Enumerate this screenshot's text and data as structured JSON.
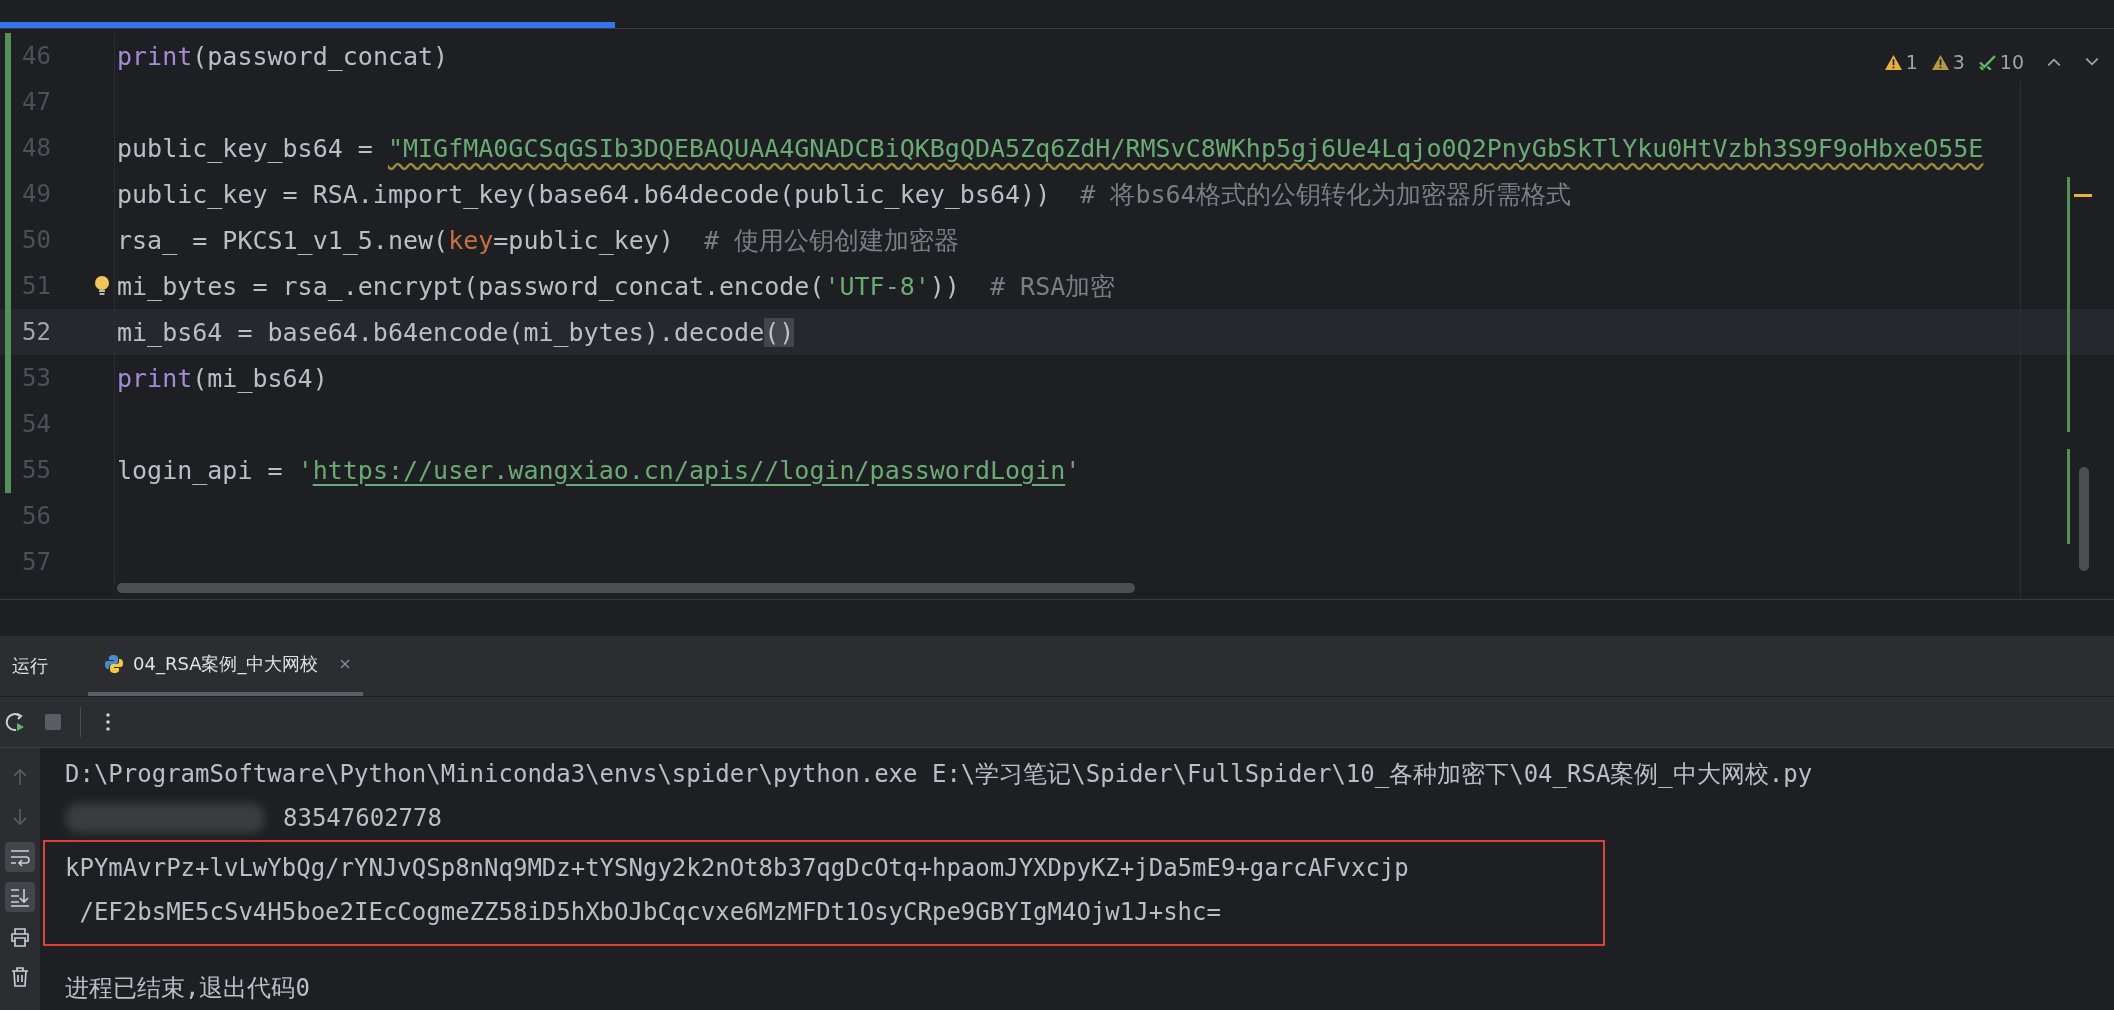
{
  "editor": {
    "inspections": [
      {
        "kind": "warning",
        "count": "1"
      },
      {
        "kind": "weak_warning",
        "count": "3"
      },
      {
        "kind": "typo",
        "count": "10"
      }
    ],
    "lines": [
      {
        "number": "46",
        "changed": true,
        "current": false,
        "bulb": false,
        "tokens": [
          {
            "kind": "fn",
            "text": "print"
          },
          {
            "kind": "plain",
            "text": "(password_concat)"
          }
        ]
      },
      {
        "number": "47",
        "changed": true,
        "current": false,
        "bulb": false
      },
      {
        "number": "48",
        "changed": true,
        "current": false,
        "bulb": false,
        "tokens": [
          {
            "kind": "plain",
            "text": "public_key_bs64 = "
          },
          {
            "kind": "str_wavy",
            "text": "\"MIGfMA0GCSqGSIb3DQEBAQUAA4GNADCBiQKBgQDA5Zq6ZdH/RMSvC8WKhp5gj6Ue4Lqjo0Q2PnyGbSkTlYku0HtVzbh3S9F9oHbxeO55E"
          }
        ]
      },
      {
        "number": "49",
        "changed": true,
        "current": false,
        "bulb": false,
        "tokens": [
          {
            "kind": "plain",
            "text": "public_key = RSA.import_key(base64.b64decode(public_key_bs64))  "
          },
          {
            "kind": "comment",
            "text": "# 将bs64格式的公钥转化为加密器所需格式"
          }
        ]
      },
      {
        "number": "50",
        "changed": true,
        "current": false,
        "bulb": false,
        "tokens": [
          {
            "kind": "plain",
            "text": "rsa_ = PKCS1_v1_5.new("
          },
          {
            "kind": "param",
            "text": "key"
          },
          {
            "kind": "plain",
            "text": "=public_key)  "
          },
          {
            "kind": "comment",
            "text": "# 使用公钥创建加密器"
          }
        ]
      },
      {
        "number": "51",
        "changed": true,
        "current": false,
        "bulb": true,
        "tokens": [
          {
            "kind": "plain",
            "text": "mi_bytes = rsa_.encrypt(password_concat.encode("
          },
          {
            "kind": "str",
            "text": "'UTF-8'"
          },
          {
            "kind": "plain",
            "text": "))  "
          },
          {
            "kind": "comment",
            "text": "# RSA加密"
          }
        ]
      },
      {
        "number": "52",
        "changed": true,
        "current": true,
        "bulb": false,
        "tokens": [
          {
            "kind": "plain",
            "text": "mi_bs64 = base64.b64encode(mi_bytes).decode"
          },
          {
            "kind": "brace",
            "text": "()"
          }
        ]
      },
      {
        "number": "53",
        "changed": true,
        "current": false,
        "bulb": false,
        "tokens": [
          {
            "kind": "fn",
            "text": "print"
          },
          {
            "kind": "plain",
            "text": "(mi_bs64)"
          }
        ]
      },
      {
        "number": "54",
        "changed": true,
        "current": false,
        "bulb": false
      },
      {
        "number": "55",
        "changed": true,
        "current": false,
        "bulb": false,
        "tokens": [
          {
            "kind": "plain",
            "text": "login_api = "
          },
          {
            "kind": "str",
            "text": "'"
          },
          {
            "kind": "url",
            "text": "https://user.wangxiao.cn/apis//login/passwordLogin"
          },
          {
            "kind": "str",
            "text": "'"
          }
        ]
      },
      {
        "number": "56",
        "changed": false,
        "current": false,
        "bulb": false
      },
      {
        "number": "57",
        "changed": false,
        "current": false,
        "bulb": false
      }
    ]
  },
  "run_panel": {
    "title": "运行",
    "tabs": [
      {
        "label": "04_RSA案例_中大网校",
        "selected": true
      }
    ],
    "side_tools": [
      {
        "kind": "up",
        "selected": false
      },
      {
        "kind": "down",
        "selected": false
      },
      {
        "kind": "wrap",
        "selected": true
      },
      {
        "kind": "scroll_end",
        "selected": true
      },
      {
        "kind": "print",
        "selected": false
      },
      {
        "kind": "trash",
        "selected": false
      }
    ],
    "console": {
      "command": "D:\\ProgramSoftware\\Python\\Miniconda3\\envs\\spider\\python.exe E:\\学习笔记\\Spider\\FullSpider\\10_各种加密下\\04_RSA案例_中大网校.py",
      "redacted_line": "83547602778",
      "highlighted_lines": [
        "kPYmAvrPz+lvLwYbQg/rYNJvQSp8nNq9MDz+tYSNgy2k2nOt8b37qgDcOtq+hpaomJYXDpyKZ+jDa5mE9+garcAFvxcjp",
        " /EF2bsME5cSv4H5boe2IEcCogmeZZ58iD5hXbOJbCqcvxe6MzMFDt1OsyCRpe9GBYIgM4Ojw1J+shc="
      ],
      "exit_message": "进程已结束,退出代码0"
    }
  }
}
